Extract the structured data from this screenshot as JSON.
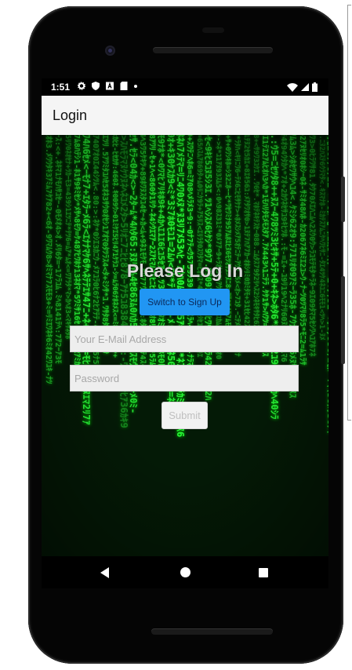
{
  "status_bar": {
    "time": "1:51",
    "left_icons": [
      "settings-icon",
      "shield-icon",
      "a-badge-icon",
      "sd-card-icon",
      "dot-icon"
    ],
    "right_icons": [
      "wifi-icon",
      "signal-icon",
      "battery-icon"
    ]
  },
  "app_bar": {
    "title": "Login"
  },
  "login": {
    "heading": "Please Log In",
    "switch_button": "Switch to Sign Up",
    "email_placeholder": "Your E-Mail Address",
    "email_value": "",
    "password_placeholder": "Password",
    "password_value": "",
    "submit_button": "Submit"
  },
  "nav_bar": {
    "icons": [
      "back-icon",
      "home-icon",
      "recents-icon"
    ]
  },
  "colors": {
    "accent": "#2196f3",
    "matrix_green": "#2aff3a",
    "appbar_bg": "#f5f5f5"
  }
}
